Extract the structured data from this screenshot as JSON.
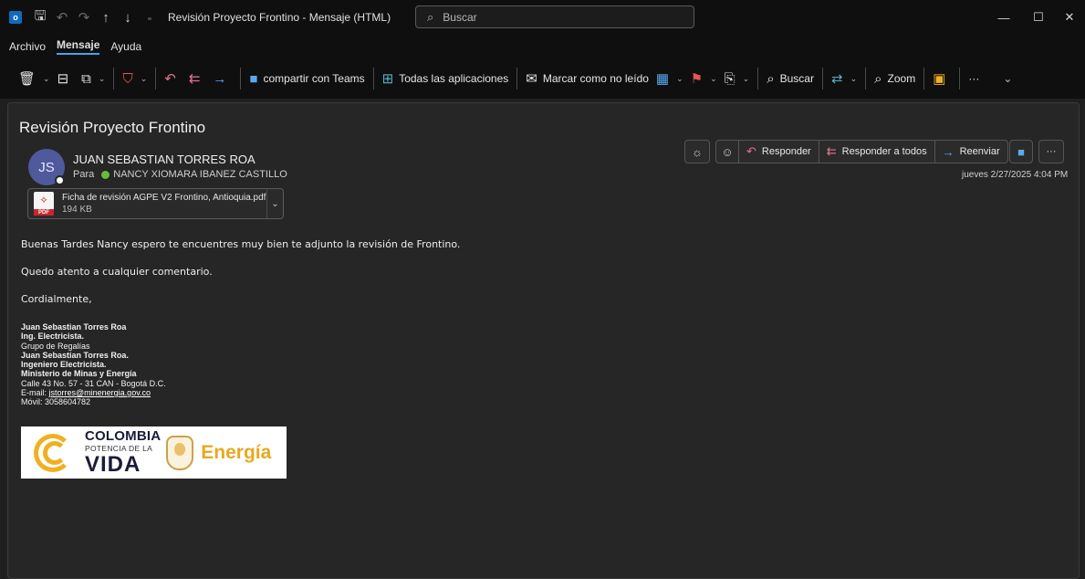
{
  "window": {
    "title": "Revisión Proyecto Frontino  -  Mensaje (HTML)",
    "search_placeholder": "Buscar",
    "qat_icons": [
      "outlook-icon",
      "save-icon",
      "undo-icon",
      "redo-icon",
      "arrow-up-icon",
      "arrow-down-icon",
      "customize-icon"
    ],
    "controls": [
      "minimize-icon",
      "maximize-icon",
      "close-icon"
    ]
  },
  "menu": {
    "items": [
      "Archivo",
      "Mensaje",
      "Ayuda"
    ],
    "active": "Mensaje"
  },
  "ribbon": {
    "teams_label": "compartir con Teams",
    "apps_label": "Todas las aplicaciones",
    "unread_label": "Marcar como no leído",
    "search_label": "Buscar",
    "zoom_label": "Zoom",
    "more_label": "···"
  },
  "message": {
    "subject": "Revisión Proyecto Frontino",
    "sender_name": "JUAN SEBASTIAN TORRES ROA",
    "sender_initials": "JS",
    "to_label": "Para",
    "to_name": "NANCY XIOMARA IBANEZ CASTILLO",
    "date": "jueves 2/27/2025 4:04 PM",
    "attachment": {
      "name": "Ficha de revisión AGPE V2 Frontino, Antioquia.pdf",
      "size": "194 KB",
      "type_label": "PDF"
    },
    "actions": {
      "reply": "Responder",
      "reply_all": "Responder a todos",
      "forward": "Reenviar",
      "more": "···"
    },
    "body": {
      "line1": "Buenas Tardes Nancy espero te encuentres muy bien te adjunto la revisión de Frontino.",
      "line2": "Quedo atento a cualquier comentario.",
      "line3": "Cordialmente,"
    },
    "signature": {
      "name1": "Juan Sebastian Torres Roa",
      "title1": "Ing. Electricista.",
      "group": "Grupo de Regalías",
      "name2": "Juan Sebastian Torres Roa.",
      "title2": "Ingeniero Electricista.",
      "org": "Ministerio de Minas y Energía",
      "address": "Calle 43 No. 57 - 31 CAN - Bogotá D.C.",
      "email_label": "E-mail: ",
      "email": "jstorres@minenergia.gov.co",
      "mobile": "Móvil: 3058604782"
    },
    "logo": {
      "line1": "COLOMBIA",
      "line2": "POTENCIA DE LA",
      "line3": "VIDA",
      "line4": "Energía"
    }
  },
  "colors": {
    "accent": "#4aa0f0",
    "avatar": "#4f5a9c",
    "presence_available": "#6bbb3a",
    "flag_red": "#e8554e",
    "logo_gold": "#e8a820"
  }
}
